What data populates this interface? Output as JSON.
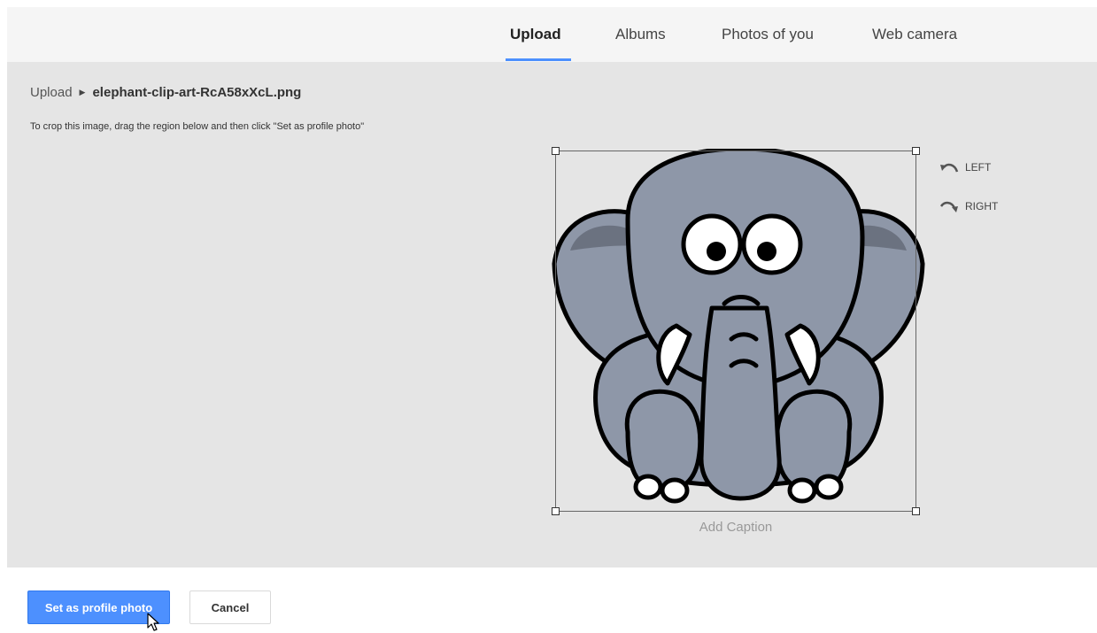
{
  "tabs": [
    {
      "label": "Upload",
      "active": true
    },
    {
      "label": "Albums",
      "active": false
    },
    {
      "label": "Photos of you",
      "active": false
    },
    {
      "label": "Web camera",
      "active": false
    }
  ],
  "breadcrumb": {
    "root": "Upload",
    "file": "elephant-clip-art-RcA58xXcL.png"
  },
  "instructions": "To crop this image, drag the region below and then click \"Set as profile photo\"",
  "rotate": {
    "left_label": "LEFT",
    "right_label": "RIGHT"
  },
  "caption_placeholder": "Add Caption",
  "actions": {
    "primary_label": "Set as profile photo",
    "cancel_label": "Cancel"
  },
  "colors": {
    "accent": "#4d90fe",
    "workspace_bg": "#e5e5e5",
    "tabbar_bg": "#f5f5f5"
  },
  "icons": [
    "rotate-left-icon",
    "rotate-right-icon",
    "breadcrumb-arrow-icon",
    "mouse-cursor-icon"
  ]
}
